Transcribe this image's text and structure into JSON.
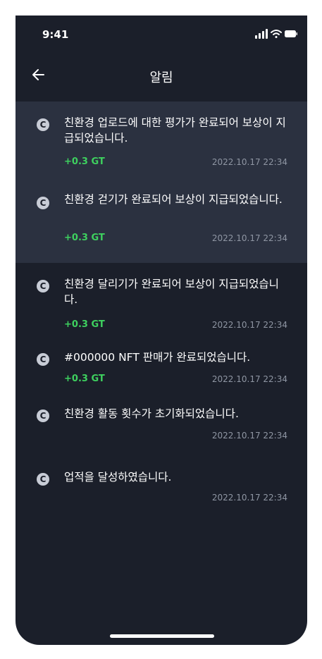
{
  "status_bar": {
    "time": "9:41"
  },
  "header": {
    "title": "알림"
  },
  "notifications": [
    {
      "message": "친환경 업로드에 대한 평가가 완료되어 보상이 지급되었습니다.",
      "reward": "+0.3 GT",
      "date": "2022.10.17  22:34",
      "unread": true
    },
    {
      "message": "친환경 걷기가 완료되어 보상이 지급되었습니다.",
      "reward": "+0.3 GT",
      "date": "2022.10.17  22:34",
      "unread": true
    },
    {
      "message": "친환경 달리기가 완료되어 보상이 지급되었습니다.",
      "reward": "+0.3 GT",
      "date": "2022.10.17  22:34",
      "unread": false
    },
    {
      "message": "#000000 NFT 판매가 완료되었습니다.",
      "reward": "+0.3 GT",
      "date": "2022.10.17 22:34",
      "unread": false
    },
    {
      "message": "친환경 활동 횟수가 초기화되었습니다.",
      "reward": "",
      "date": "2022.10.17 22:34",
      "unread": false
    },
    {
      "message": "업적을 달성하였습니다.",
      "reward": "",
      "date": "2022.10.17 22:34",
      "unread": false
    }
  ],
  "icons": {
    "back": "arrow-left-icon",
    "coin": "coin-c-icon"
  },
  "colors": {
    "background": "#1b1f2a",
    "unread_background": "#2b3140",
    "reward": "#3ed15f",
    "date": "#8f96a3"
  }
}
